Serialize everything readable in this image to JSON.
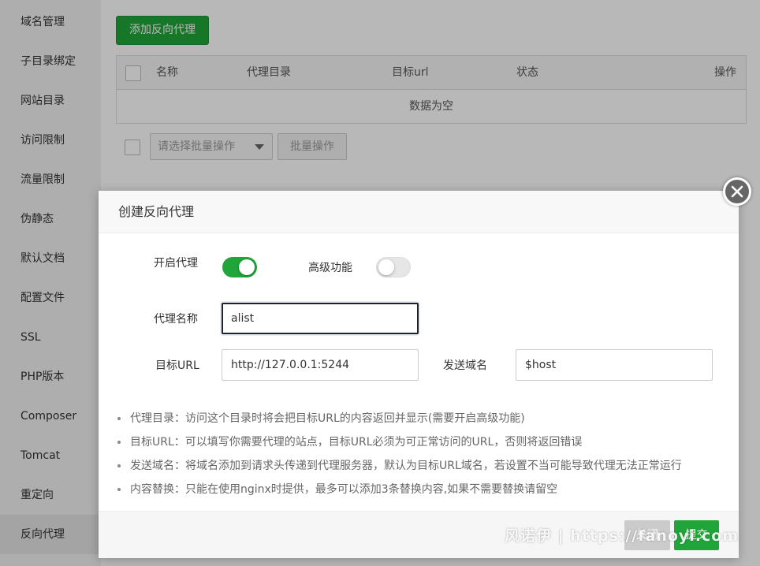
{
  "sidebar": {
    "items": [
      {
        "label": "域名管理"
      },
      {
        "label": "子目录绑定"
      },
      {
        "label": "网站目录"
      },
      {
        "label": "访问限制"
      },
      {
        "label": "流量限制"
      },
      {
        "label": "伪静态"
      },
      {
        "label": "默认文档"
      },
      {
        "label": "配置文件"
      },
      {
        "label": "SSL"
      },
      {
        "label": "PHP版本"
      },
      {
        "label": "Composer"
      },
      {
        "label": "Tomcat"
      },
      {
        "label": "重定向"
      },
      {
        "label": "反向代理"
      }
    ],
    "active": "反向代理"
  },
  "main": {
    "add_button": "添加反向代理",
    "table": {
      "columns": [
        "名称",
        "代理目录",
        "目标url",
        "状态",
        "操作"
      ],
      "empty_text": "数据为空"
    },
    "batch_select_placeholder": "请选择批量操作",
    "batch_button": "批量操作"
  },
  "modal": {
    "title": "创建反向代理",
    "enable_proxy": {
      "label": "开启代理",
      "on": true
    },
    "advanced": {
      "label": "高级功能",
      "on": false
    },
    "proxy_name": {
      "label": "代理名称",
      "value": "alist"
    },
    "target_url": {
      "label": "目标URL",
      "value": "http://127.0.0.1:5244"
    },
    "send_domain": {
      "label": "发送域名",
      "value": "$host"
    },
    "notes": [
      "代理目录：访问这个目录时将会把目标URL的内容返回并显示(需要开启高级功能)",
      "目标URL：可以填写你需要代理的站点，目标URL必须为可正常访问的URL，否则将返回错误",
      "发送域名：将域名添加到请求头传递到代理服务器，默认为目标URL域名，若设置不当可能导致代理无法正常运行",
      "内容替换：只能在使用nginx时提供，最多可以添加3条替换内容,如果不需要替换请留空"
    ],
    "close_button": "关闭",
    "submit_button": "提交"
  },
  "watermark": "风诺伊 | https://fanoyi.com",
  "colors": {
    "accent": "#20a53a",
    "sidebar_bg": "#f2f2f2",
    "overlay": "rgba(0,0,0,0.28)"
  }
}
